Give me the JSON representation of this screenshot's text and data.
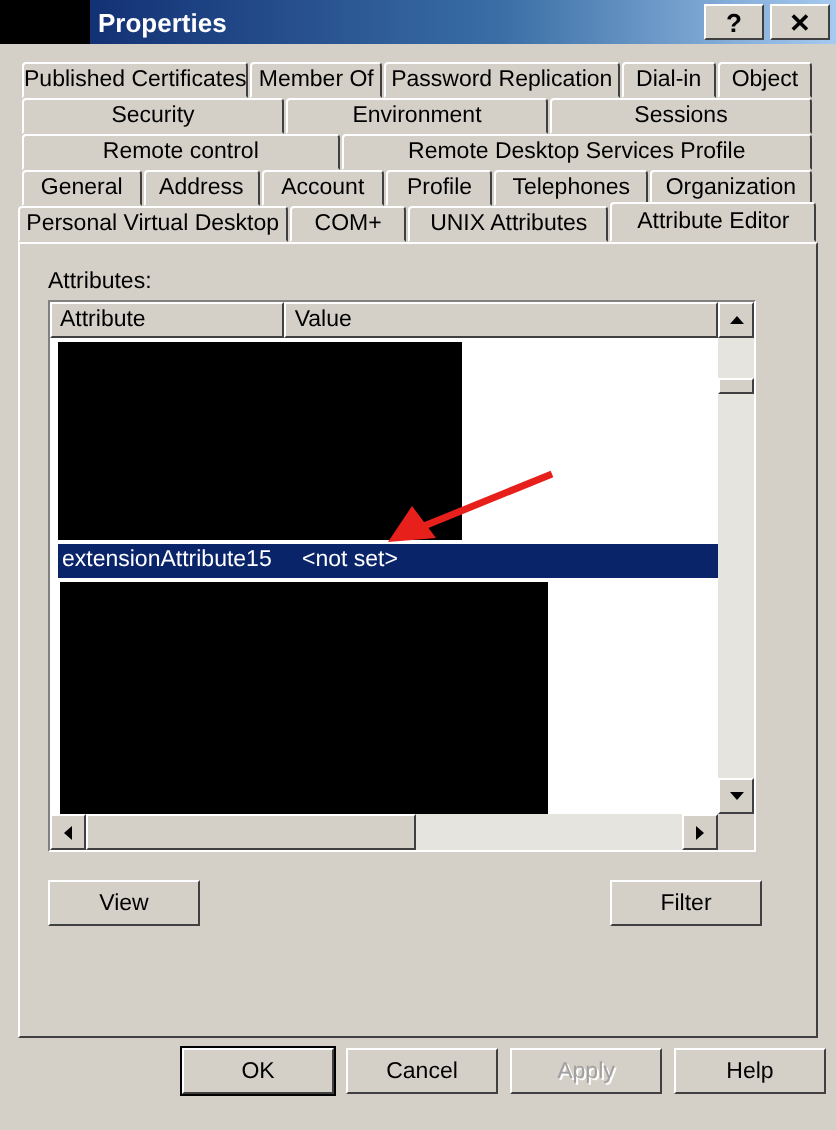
{
  "window": {
    "title": "Properties",
    "help_button": "?",
    "close_button": "✕"
  },
  "tab_rows": [
    [
      {
        "label": "Published Certificates",
        "selected": false
      },
      {
        "label": "Member Of",
        "selected": false
      },
      {
        "label": "Password Replication",
        "selected": false
      },
      {
        "label": "Dial-in",
        "selected": false
      },
      {
        "label": "Object",
        "selected": false
      }
    ],
    [
      {
        "label": "Security",
        "selected": false
      },
      {
        "label": "Environment",
        "selected": false
      },
      {
        "label": "Sessions",
        "selected": false
      }
    ],
    [
      {
        "label": "Remote control",
        "selected": false
      },
      {
        "label": "Remote Desktop Services Profile",
        "selected": false
      }
    ],
    [
      {
        "label": "General",
        "selected": false
      },
      {
        "label": "Address",
        "selected": false
      },
      {
        "label": "Account",
        "selected": false
      },
      {
        "label": "Profile",
        "selected": false
      },
      {
        "label": "Telephones",
        "selected": false
      },
      {
        "label": "Organization",
        "selected": false
      }
    ],
    [
      {
        "label": "Personal Virtual Desktop",
        "selected": false
      },
      {
        "label": "COM+",
        "selected": false
      },
      {
        "label": "UNIX Attributes",
        "selected": false
      },
      {
        "label": "Attribute Editor",
        "selected": true
      }
    ]
  ],
  "attributes": {
    "label": "Attributes:",
    "columns": [
      "Attribute",
      "Value"
    ],
    "rows": [
      {
        "kind": "redacted"
      },
      {
        "kind": "entry",
        "attribute": "extensionAttribute15",
        "value": "<not set>",
        "selected": true
      },
      {
        "kind": "redacted"
      }
    ]
  },
  "list_buttons": [
    "View",
    "Filter"
  ],
  "dialog_buttons": [
    {
      "label": "OK",
      "default": true,
      "disabled": false
    },
    {
      "label": "Cancel",
      "default": false,
      "disabled": false
    },
    {
      "label": "Apply",
      "default": false,
      "disabled": true
    },
    {
      "label": "Help",
      "default": false,
      "disabled": false
    }
  ]
}
